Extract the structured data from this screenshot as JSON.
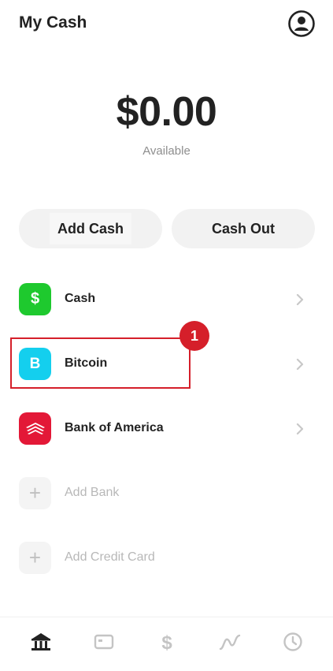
{
  "header": {
    "title": "My Cash",
    "profile_icon": "profile-icon"
  },
  "balance": {
    "amount": "$0.00",
    "caption": "Available"
  },
  "actions": {
    "add_cash": "Add Cash",
    "cash_out": "Cash Out"
  },
  "accounts": [
    {
      "label": "Cash",
      "icon": "dollar-icon",
      "glyph": "$",
      "color": "#1ec92e"
    },
    {
      "label": "Bitcoin",
      "icon": "bitcoin-icon",
      "glyph": "B",
      "color": "#14cfee"
    },
    {
      "label": "Bank of America",
      "icon": "bank-of-america-icon",
      "color": "#e31837"
    },
    {
      "label": "Add Bank",
      "icon": "plus-icon",
      "glyph": "+"
    },
    {
      "label": "Add Credit Card",
      "icon": "plus-icon",
      "glyph": "+"
    }
  ],
  "annotation": {
    "marker": "1",
    "color": "#d51f2a"
  },
  "tabbar": {
    "tabs": [
      "bank-icon",
      "card-icon",
      "dollar-icon",
      "investing-icon",
      "activity-icon"
    ]
  }
}
